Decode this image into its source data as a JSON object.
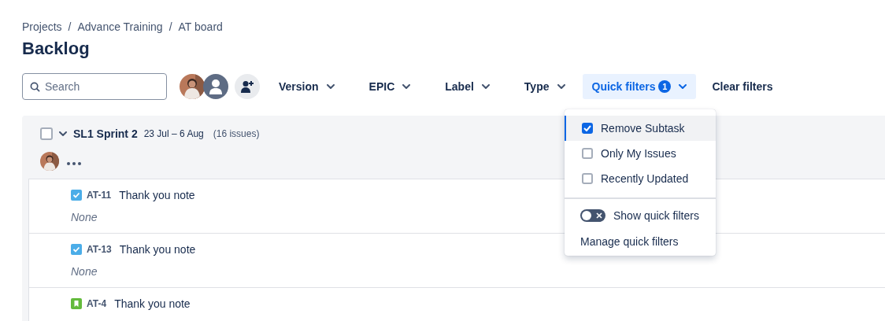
{
  "breadcrumbs": [
    {
      "label": "Projects",
      "separator": "/"
    },
    {
      "label": "Advance Training",
      "separator": "/"
    },
    {
      "label": "AT board"
    }
  ],
  "title": "Backlog",
  "search": {
    "placeholder": "Search"
  },
  "avatars": [
    {
      "kind": "photo"
    },
    {
      "kind": "default"
    }
  ],
  "filters": [
    {
      "label": "Version",
      "selected": false
    },
    {
      "label": "EPIC",
      "selected": false
    },
    {
      "label": "Label",
      "selected": false
    },
    {
      "label": "Type",
      "selected": false
    },
    {
      "label": "Quick filters",
      "badge": "1",
      "selected": true
    }
  ],
  "clear_filters": "Clear filters",
  "sprint": {
    "name": "SL1 Sprint 2",
    "dates": "23 Jul – 6 Aug",
    "count": "(16 issues)",
    "checked": false,
    "expanded": true,
    "issues": [
      {
        "kind": "task",
        "key": "AT-11",
        "summary": "Thank you note",
        "epic": "None"
      },
      {
        "kind": "task",
        "key": "AT-13",
        "summary": "Thank you note",
        "epic": "None"
      },
      {
        "kind": "story",
        "key": "AT-4",
        "summary": "Thank you note"
      }
    ]
  },
  "quick_filters_menu": {
    "items": [
      {
        "label": "Remove Subtask",
        "checked": true,
        "selected": true
      },
      {
        "label": "Only My Issues",
        "checked": false,
        "selected": false
      },
      {
        "label": "Recently Updated",
        "checked": false,
        "selected": false
      }
    ],
    "toggle": {
      "label": "Show quick filters",
      "on": false
    },
    "manage": "Manage quick filters"
  }
}
